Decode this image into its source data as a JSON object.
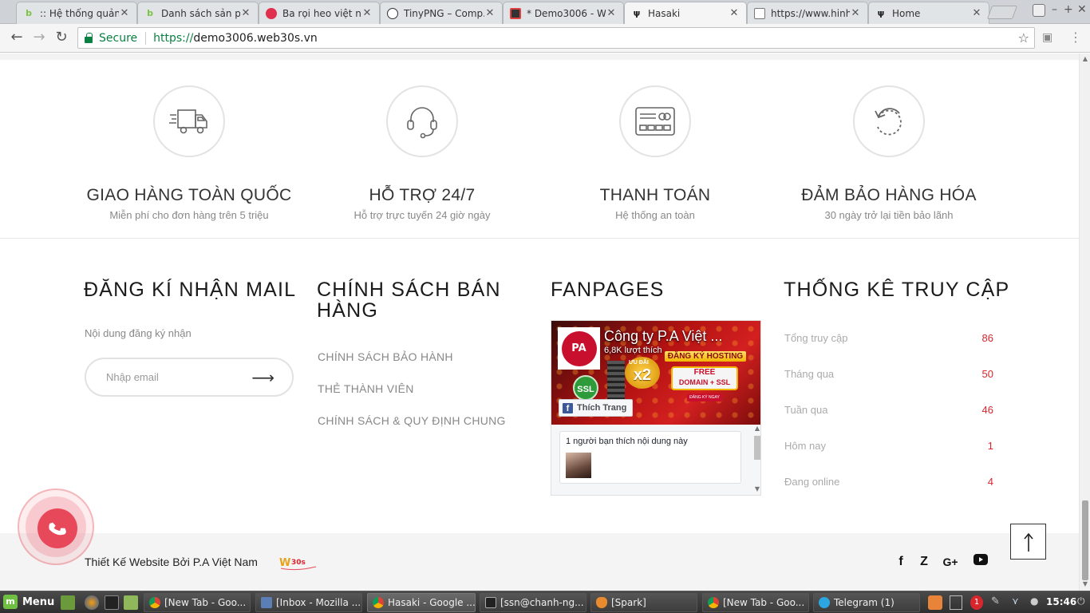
{
  "browser": {
    "tabs": [
      {
        "title": ":: Hệ thống quản...",
        "favicon": "b-green-icon",
        "active": false
      },
      {
        "title": "Danh sách sản p...",
        "favicon": "b-green-icon",
        "active": false
      },
      {
        "title": "Ba rọi heo việt n...",
        "favicon": "red-circle-icon",
        "active": false
      },
      {
        "title": "TinyPNG – Comp...",
        "favicon": "panda-icon",
        "active": false
      },
      {
        "title": "* Demo3006 - W...",
        "favicon": "dark-square-icon",
        "active": false
      },
      {
        "title": "Hasaki",
        "favicon": "fork-knife-icon",
        "active": true
      },
      {
        "title": "https://www.hinh...",
        "favicon": "page-icon",
        "active": false
      },
      {
        "title": "Home",
        "favicon": "fork-knife-icon",
        "active": false
      }
    ],
    "secure_label": "Secure",
    "url_scheme": "https://",
    "url_host": "demo3006.web30s.vn"
  },
  "features": [
    {
      "icon": "truck-icon",
      "title": "GIAO HÀNG TOÀN QUỐC",
      "subtitle": "Miễn phí cho đơn hàng trên 5 triệu"
    },
    {
      "icon": "headset-icon",
      "title": "HỖ TRỢ 24/7",
      "subtitle": "Hỗ trợ trực tuyến 24 giờ ngày"
    },
    {
      "icon": "credit-card-icon",
      "title": "THANH TOÁN",
      "subtitle": "Hệ thống an toàn"
    },
    {
      "icon": "refresh-icon",
      "title": "ĐẢM BẢO HÀNG HÓA",
      "subtitle": "30 ngày trở lại tiền bảo lãnh"
    }
  ],
  "newsletter": {
    "title": "ĐĂNG KÍ NHẬN MAIL",
    "description": "Nội dung đăng ký nhận",
    "placeholder": "Nhập email"
  },
  "policy": {
    "title_line1": "CHÍNH SÁCH BÁN",
    "title_line2": "HÀNG",
    "links": [
      "CHÍNH SÁCH BẢO HÀNH",
      "THẺ THÀNH VIÊN",
      "CHÍNH SÁCH & QUY ĐỊNH CHUNG"
    ]
  },
  "fanpages": {
    "title": "FANPAGES",
    "page_name": "Công ty P.A Việt ...",
    "likes": "6,8K lượt thích",
    "ad_headline": "ĐĂNG KÝ HOSTING",
    "ad_offer": "ƯU ĐÃI",
    "ad_multiplier": "x2",
    "ad_free_line1": "FREE",
    "ad_free_line2": "DOMAIN + SSL",
    "ad_register": "ĐĂNG KÝ NGAY",
    "ad_ssl": "SSL",
    "like_button": "Thích Trang",
    "friend_text": "1 người bạn thích nội dung này"
  },
  "stats": {
    "title": "THỐNG KÊ TRUY CẬP",
    "rows": [
      {
        "label": "Tổng truy cập",
        "value": "86"
      },
      {
        "label": "Tháng qua",
        "value": "50"
      },
      {
        "label": "Tuần qua",
        "value": "46"
      },
      {
        "label": "Hôm nay",
        "value": "1"
      },
      {
        "label": "Đang online",
        "value": "4"
      }
    ]
  },
  "footer": {
    "credit": "Thiết Kế Website Bởi P.A Việt Nam",
    "social": [
      "facebook-icon",
      "zalo-icon",
      "google-plus-icon",
      "youtube-icon"
    ]
  },
  "taskbar": {
    "menu_label": "Menu",
    "tasks": [
      {
        "label": "[New Tab - Goo...",
        "icon": "chrome-icon",
        "active": false
      },
      {
        "label": "[Inbox - Mozilla ...",
        "icon": "thunderbird-icon",
        "active": false
      },
      {
        "label": "Hasaki - Google ...",
        "icon": "chrome-icon",
        "active": true
      },
      {
        "label": "[ssn@chanh-ng...",
        "icon": "terminal-icon",
        "active": false
      },
      {
        "label": "[Spark]",
        "icon": "spark-icon",
        "active": false
      },
      {
        "label": "[New Tab - Goo...",
        "icon": "chrome-icon",
        "active": false
      },
      {
        "label": "Telegram (1)",
        "icon": "telegram-icon",
        "active": false
      }
    ],
    "clock": "15:46",
    "notification_count": "1"
  },
  "colors": {
    "accent_red": "#d7262d",
    "call_button": "#e8495a",
    "secure_green": "#0b8043"
  }
}
